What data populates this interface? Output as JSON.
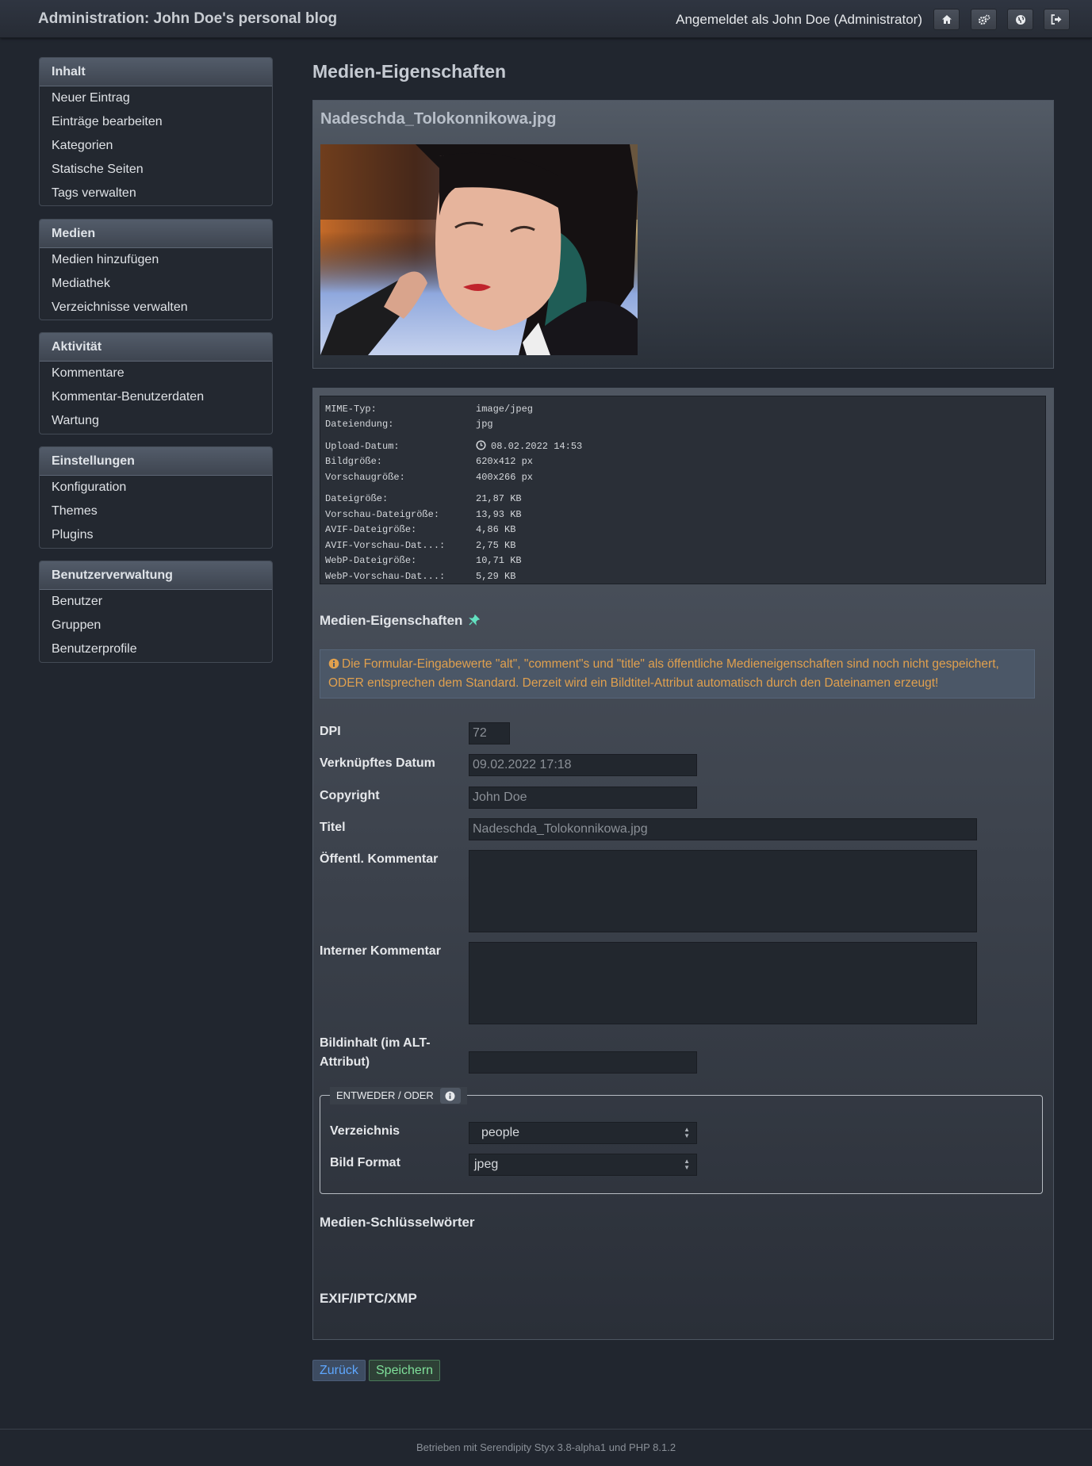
{
  "header": {
    "title": "Administration: John Doe's personal blog",
    "user": "Angemeldet als John Doe (Administrator)",
    "icons": [
      "home-icon",
      "cogs-icon",
      "globe-icon",
      "logout-icon"
    ]
  },
  "sidebar": {
    "sections": [
      {
        "title": "Inhalt",
        "items": [
          "Neuer Eintrag",
          "Einträge bearbeiten",
          "Kategorien",
          "Statische Seiten",
          "Tags verwalten"
        ]
      },
      {
        "title": "Medien",
        "items": [
          "Medien hinzufügen",
          "Mediathek",
          "Verzeichnisse verwalten"
        ]
      },
      {
        "title": "Aktivität",
        "items": [
          "Kommentare",
          "Kommentar-Benutzerdaten",
          "Wartung"
        ]
      },
      {
        "title": "Einstellungen",
        "items": [
          "Konfiguration",
          "Themes",
          "Plugins"
        ]
      },
      {
        "title": "Benutzerverwaltung",
        "items": [
          "Benutzer",
          "Gruppen",
          "Benutzerprofile"
        ]
      }
    ]
  },
  "main": {
    "page_title": "Medien-Eigenschaften",
    "filename": "Nadeschda_Tolokonnikowa.jpg",
    "meta": {
      "mime_label": "MIME-Typ:",
      "mime": "image/jpeg",
      "ext_label": "Dateiendung:",
      "ext": "jpg",
      "upload_label": "Upload-Datum:",
      "upload": "08.02.2022 14:53",
      "size_label": "Bildgröße:",
      "size": "620x412 px",
      "preview_label": "Vorschaugröße:",
      "preview": "400x266 px",
      "filesize_label": "Dateigröße:",
      "filesize": "21,87 KB",
      "prev_filesize_label": "Vorschau-Dateigröße:",
      "prev_filesize": "13,93 KB",
      "avif_label": "AVIF-Dateigröße:",
      "avif": "4,86 KB",
      "avif_prev_label": "AVIF-Vorschau-Dat...:",
      "avif_prev": "2,75 KB",
      "webp_label": "WebP-Dateigröße:",
      "webp": "10,71 KB",
      "webp_prev_label": "WebP-Vorschau-Dat...:",
      "webp_prev": "5,29 KB"
    },
    "props_title": "Medien-Eigenschaften",
    "notice": "Die Formular-Eingabewerte \"alt\", \"comment\"s und \"title\" als öffentliche Medieneigenschaften sind noch nicht gespeichert, ODER entsprechen dem Standard. Derzeit wird ein Bildtitel-Attribut automatisch durch den Dateinamen erzeugt!",
    "form": {
      "dpi_label": "DPI",
      "dpi": "72",
      "date_label": "Verknüpftes Datum",
      "date": "09.02.2022 17:18",
      "copyright_label": "Copyright",
      "copyright": "John Doe",
      "title_label": "Titel",
      "title": "Nadeschda_Tolokonnikowa.jpg",
      "public_comment_label": "Öffentl. Kommentar",
      "public_comment": "",
      "internal_comment_label": "Interner Kommentar",
      "internal_comment": "",
      "alt_label": "Bildinhalt (im ALT-Attribut)",
      "alt": ""
    },
    "either_or": {
      "legend": "ENTWEDER / ODER",
      "dir_label": "Verzeichnis",
      "dir": "people",
      "format_label": "Bild Format",
      "format": "jpeg"
    },
    "keywords_title": "Medien-Schlüsselwörter",
    "exif_title": "EXIF/IPTC/XMP",
    "back_button": "Zurück",
    "save_button": "Speichern"
  },
  "footer": "Betrieben mit Serendipity Styx 3.8-alpha1 und PHP 8.1.2",
  "colors": {
    "background": "#21262f",
    "notice_text": "#e0a04e",
    "back": "#5ea7ff",
    "save": "#7fe09a"
  }
}
